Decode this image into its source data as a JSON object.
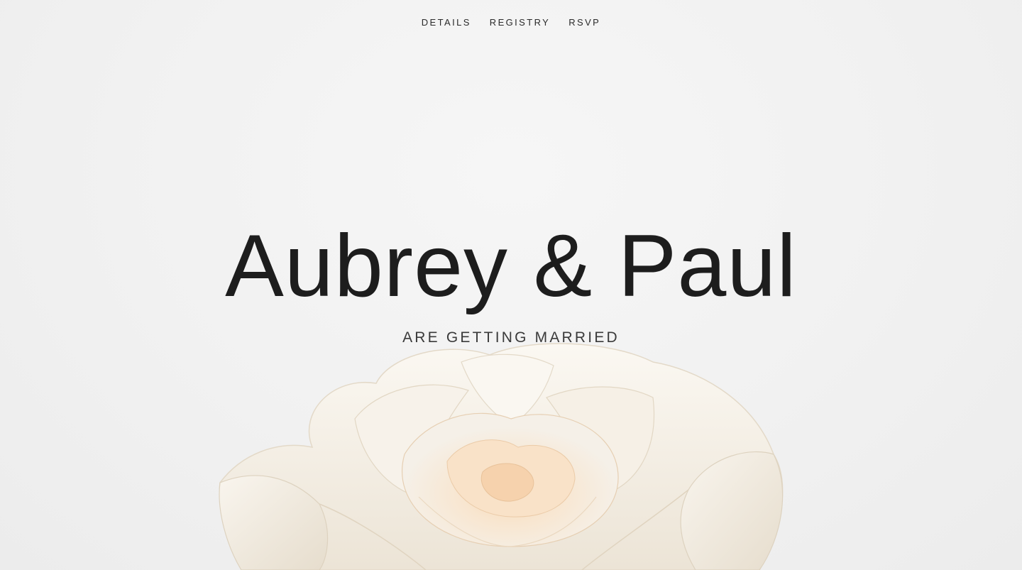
{
  "nav": {
    "items": [
      {
        "label": "DETAILS"
      },
      {
        "label": "REGISTRY"
      },
      {
        "label": "RSVP"
      }
    ]
  },
  "hero": {
    "title": "Aubrey & Paul",
    "subtitle": "ARE GETTING MARRIED",
    "image": "white-rose-photo"
  },
  "colors": {
    "background": "#f2f2f2",
    "text": "#1d1d1d",
    "rose_petal": "#f4efe6",
    "rose_blush": "#f7d9b8"
  }
}
